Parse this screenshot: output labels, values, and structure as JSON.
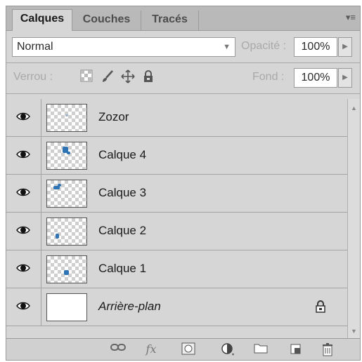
{
  "tabs": [
    {
      "label": "Calques",
      "active": true
    },
    {
      "label": "Couches",
      "active": false
    },
    {
      "label": "Tracés",
      "active": false
    }
  ],
  "panel_menu_icon": "panel-menu-icon",
  "blend_mode": "Normal",
  "opacity": {
    "label": "Opacité :",
    "value": "100%"
  },
  "lock": {
    "label": "Verrou :",
    "icons": [
      "lock-transparent-icon",
      "lock-brush-icon",
      "lock-move-icon",
      "lock-all-icon"
    ]
  },
  "fill": {
    "label": "Fond :",
    "value": "100%"
  },
  "layers": [
    {
      "name": "Zozor",
      "visible": true,
      "italic": false,
      "locked": false,
      "thumb": "transparent"
    },
    {
      "name": "Calque 4",
      "visible": true,
      "italic": false,
      "locked": false,
      "thumb": "transparent"
    },
    {
      "name": "Calque 3",
      "visible": true,
      "italic": false,
      "locked": false,
      "thumb": "transparent"
    },
    {
      "name": "Calque 2",
      "visible": true,
      "italic": false,
      "locked": false,
      "thumb": "transparent"
    },
    {
      "name": "Calque 1",
      "visible": true,
      "italic": false,
      "locked": false,
      "thumb": "transparent"
    },
    {
      "name": "Arrière-plan",
      "visible": true,
      "italic": true,
      "locked": true,
      "thumb": "white"
    }
  ],
  "bottom_icons": [
    "link-icon",
    "fx-icon",
    "mask-icon",
    "adjustment-icon",
    "folder-icon",
    "new-layer-icon",
    "trash-icon"
  ],
  "colors": {
    "panel_bg": "#d6d6d6",
    "thumb_accent": "#2e74b5"
  }
}
